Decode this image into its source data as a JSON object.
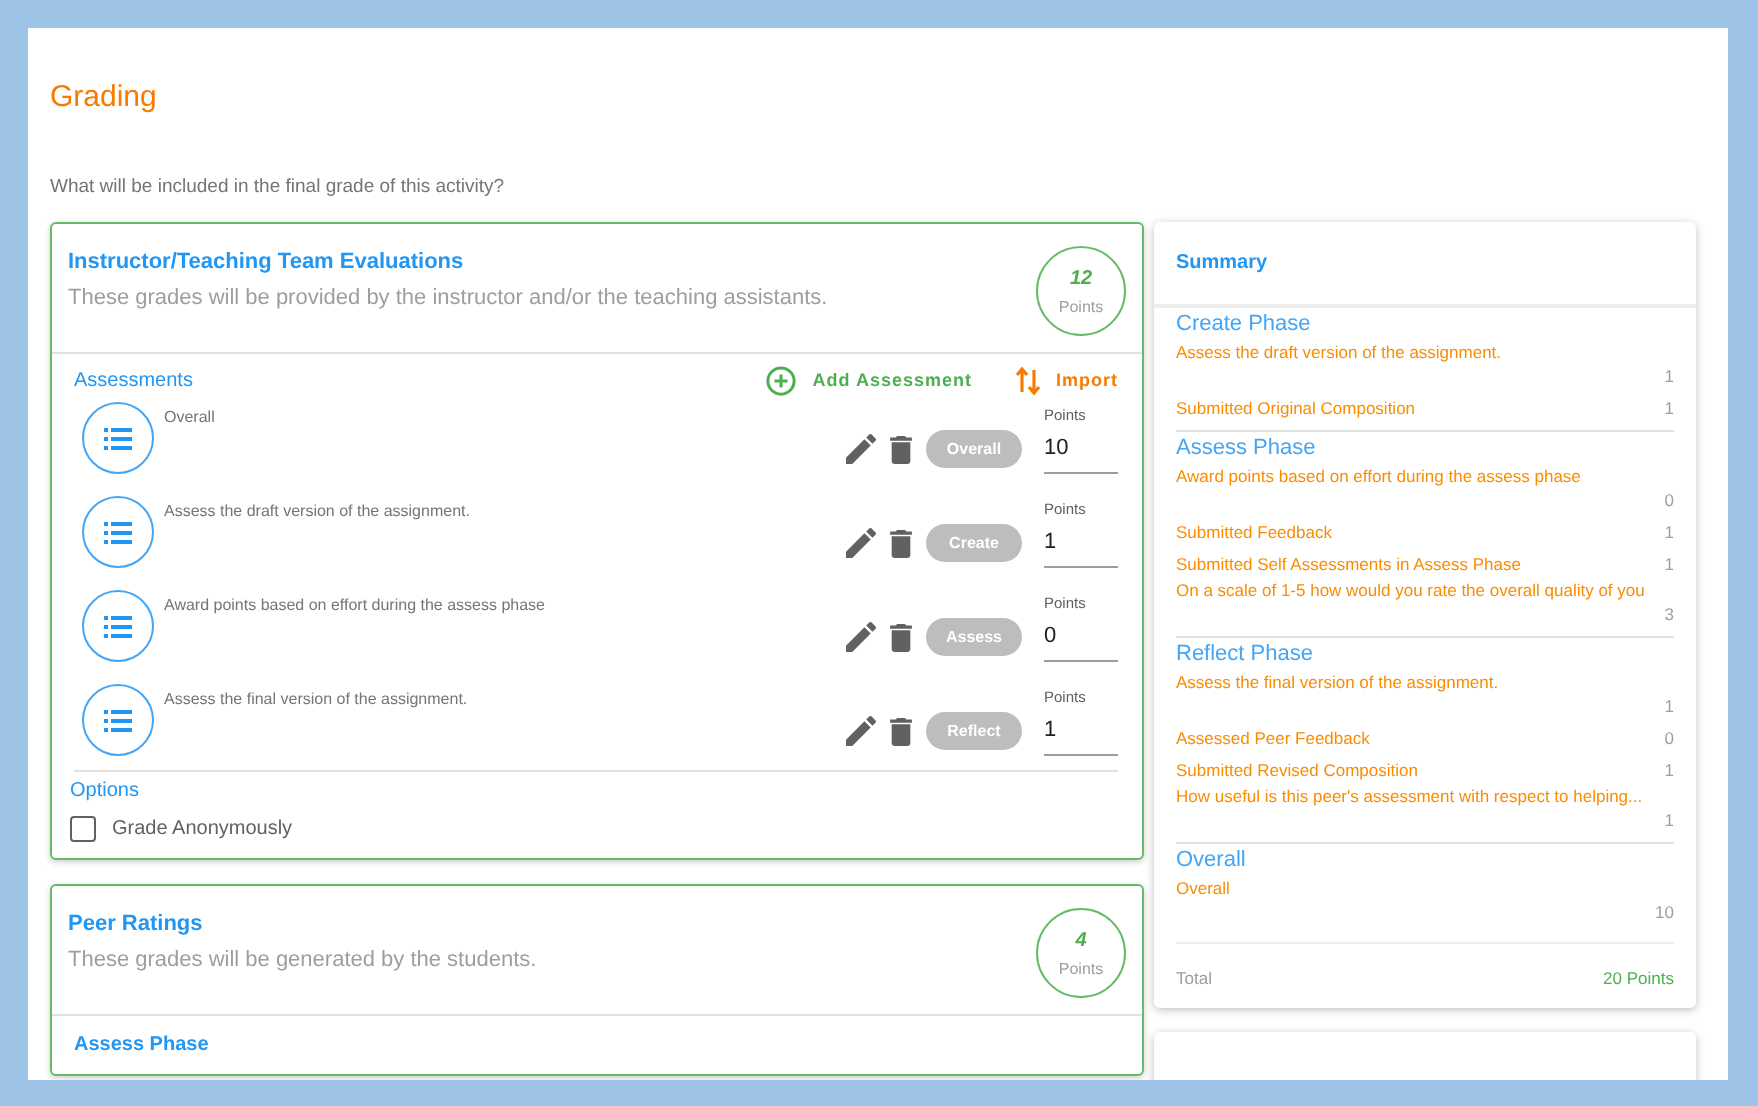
{
  "page": {
    "title": "Grading",
    "question": "What will be included in the final grade of this activity?"
  },
  "sections": [
    {
      "title": "Instructor/Teaching Team Evaluations",
      "description": "These grades will be provided by the instructor and/or the teaching assistants.",
      "points": "12",
      "points_label": "Points",
      "assessments_label": "Assessments",
      "actions": [
        {
          "kind": "add",
          "label": "Add Assessment"
        },
        {
          "kind": "import",
          "label": "Import"
        }
      ],
      "assessments": [
        {
          "description": "Overall",
          "phase": "Overall",
          "points_label": "Points",
          "points": "10"
        },
        {
          "description": "Assess the draft version of the assignment.",
          "phase": "Create",
          "points_label": "Points",
          "points": "1"
        },
        {
          "description": "Award points based on effort during the assess phase",
          "phase": "Assess",
          "points_label": "Points",
          "points": "0"
        },
        {
          "description": "Assess the final version of the assignment.",
          "phase": "Reflect",
          "points_label": "Points",
          "points": "1"
        }
      ],
      "options_label": "Options",
      "options": [
        {
          "label": "Grade Anonymously",
          "checked": false
        }
      ]
    },
    {
      "title": "Peer Ratings",
      "description": "These grades will be generated by the students.",
      "points": "4",
      "points_label": "Points",
      "subheading": "Assess Phase"
    }
  ],
  "summary": {
    "title": "Summary",
    "groups": [
      {
        "title": "Create Phase",
        "items": [
          {
            "kind": "stacked",
            "label": "Assess the draft version of the assignment.",
            "value": "1"
          },
          {
            "kind": "inline",
            "label": "Submitted Original Composition",
            "value": "1"
          }
        ]
      },
      {
        "title": "Assess Phase",
        "items": [
          {
            "kind": "stacked",
            "label": "Award points based on effort during the assess phase",
            "value": "0"
          },
          {
            "kind": "inline",
            "label": "Submitted Feedback",
            "value": "1"
          },
          {
            "kind": "inline",
            "label": "Submitted Self Assessments in Assess Phase",
            "value": "1"
          },
          {
            "kind": "stacked",
            "label": "On a scale of 1-5 how would you rate the overall quality of you",
            "value": "3"
          }
        ]
      },
      {
        "title": "Reflect Phase",
        "items": [
          {
            "kind": "stacked",
            "label": "Assess the final version of the assignment.",
            "value": "1"
          },
          {
            "kind": "inline",
            "label": "Assessed Peer Feedback",
            "value": "0"
          },
          {
            "kind": "inline",
            "label": "Submitted Revised Composition",
            "value": "1"
          },
          {
            "kind": "stacked",
            "label": "How useful is this peer's assessment with respect to helping...",
            "value": "1"
          }
        ]
      },
      {
        "title": "Overall",
        "items": [
          {
            "kind": "stacked",
            "label": "Overall",
            "value": "10"
          }
        ]
      }
    ],
    "total_label": "Total",
    "total": "20 Points"
  }
}
